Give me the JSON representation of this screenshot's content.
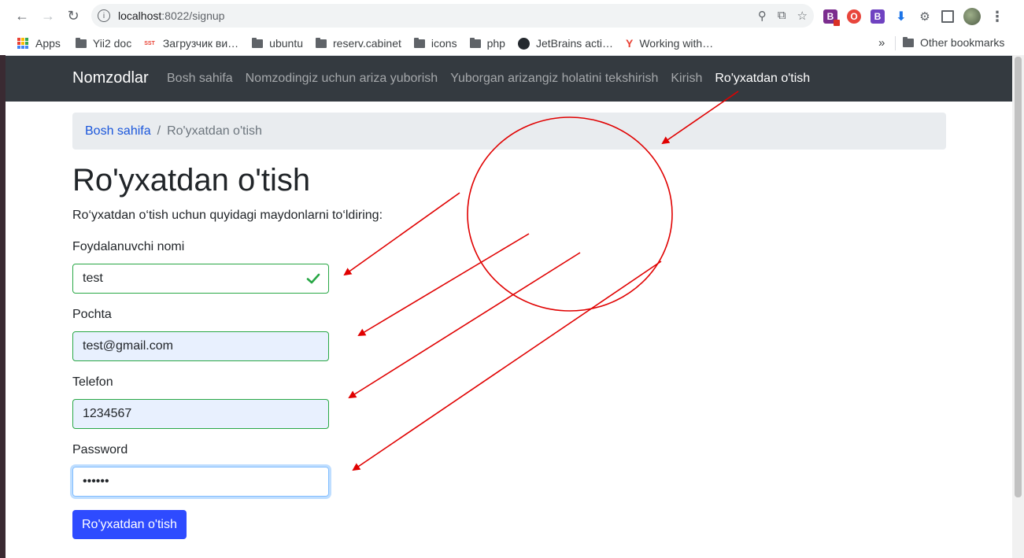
{
  "browser": {
    "url_host": "localhost",
    "url_path": ":8022/signup",
    "bookmarks": [
      {
        "label": "Apps",
        "icon": "apps-grid-icon"
      },
      {
        "label": "Yii2 doc",
        "icon": "folder-icon"
      },
      {
        "label": "Загрузчик ви…",
        "icon": "sst-icon"
      },
      {
        "label": "ubuntu",
        "icon": "folder-icon"
      },
      {
        "label": "reserv.cabinet",
        "icon": "folder-icon"
      },
      {
        "label": "icons",
        "icon": "folder-icon"
      },
      {
        "label": "php",
        "icon": "folder-icon"
      },
      {
        "label": "JetBrains acti…",
        "icon": "github-icon"
      },
      {
        "label": "Working with…",
        "icon": "yii-icon"
      }
    ],
    "overflow": "»",
    "other_bookmarks": "Other bookmarks",
    "sst_icon_text": "SST",
    "extensions": [
      {
        "text": "B",
        "color": "#7b2d8e"
      },
      {
        "text": "O",
        "color": "#e8453c"
      },
      {
        "text": "B",
        "color": "#6f42c1"
      }
    ]
  },
  "navbar": {
    "brand": "Nomzodlar",
    "links": [
      "Bosh sahifa",
      "Nomzodingiz uchun ariza yuborish",
      "Yuborgan arizangiz holatini tekshirish",
      "Kirish",
      "Ro'yxatdan o'tish"
    ]
  },
  "breadcrumb": {
    "home": "Bosh sahifa",
    "separator": "/",
    "current": "Ro'yxatdan o'tish"
  },
  "page": {
    "title": "Ro'yxatdan o'tish",
    "lead": "Ro‘yxatdan o‘tish uchun quyidagi maydonlarni to‘ldiring:"
  },
  "form": {
    "username_label": "Foydalanuvchi nomi",
    "username_value": "test",
    "email_label": "Pochta",
    "email_value": "test@gmail.com",
    "phone_label": "Telefon",
    "phone_value": "1234567",
    "password_label": "Password",
    "password_value": "••••••",
    "submit_label": "Ro'yxatdan o'tish"
  },
  "colors": {
    "navbar_bg": "#343a40",
    "valid_border": "#28a745",
    "submit_bg": "#2e4bff",
    "annotation": "#e00000"
  }
}
